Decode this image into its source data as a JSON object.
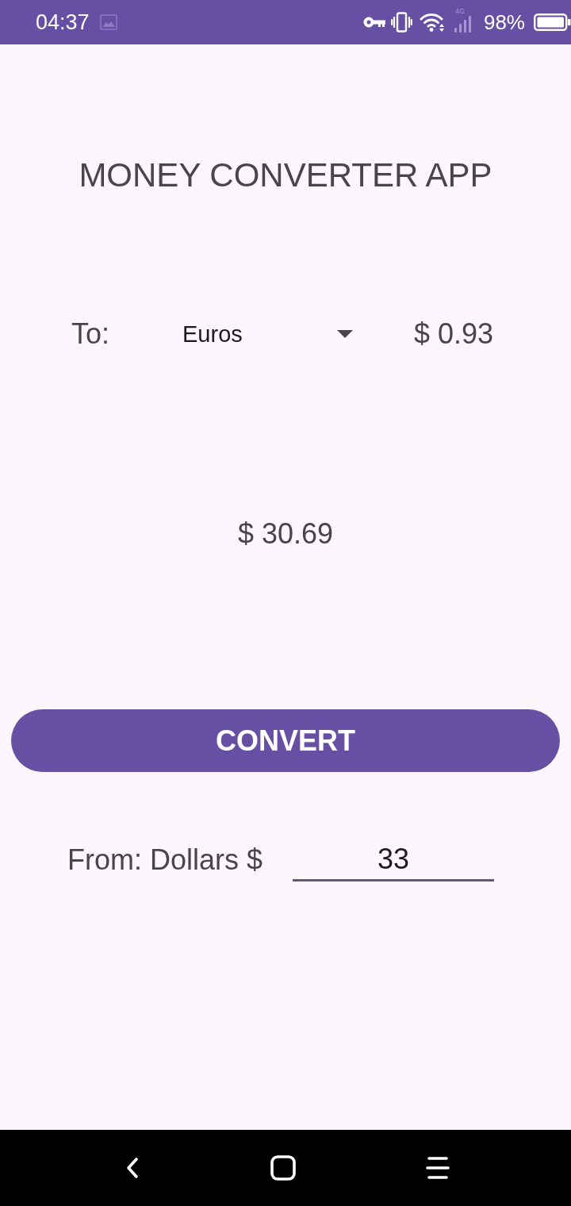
{
  "status_bar": {
    "time": "04:37",
    "network_type": "4G",
    "battery_percent": "98%"
  },
  "title": "MONEY CONVERTER APP",
  "target": {
    "label": "To:",
    "currency": "Euros",
    "rate": "$ 0.93"
  },
  "result": "$ 30.69",
  "convert_button": {
    "label": "CONVERT"
  },
  "source": {
    "label": "From: Dollars $",
    "amount": "33"
  }
}
